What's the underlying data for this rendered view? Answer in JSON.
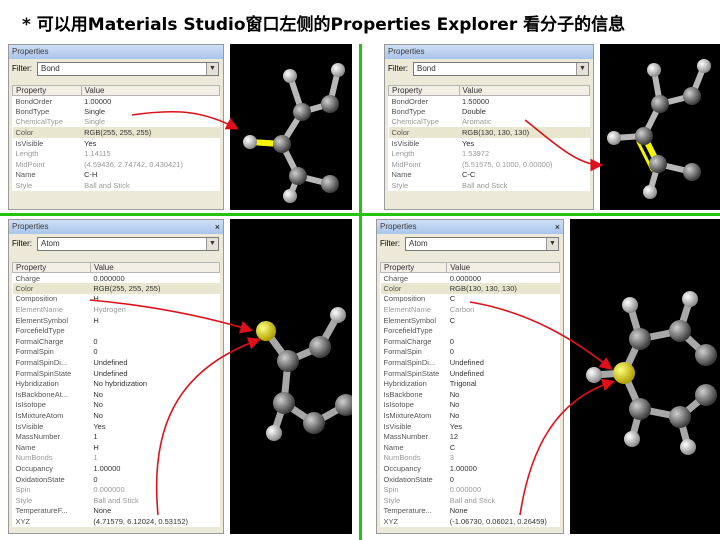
{
  "title": "* 可以用Materials Studio窗口左侧的Properties Explorer 看分子的信息",
  "colors": {
    "divider": "#22c40e",
    "arrow": "#e0101a",
    "highlight_atom": "#e8e000",
    "hydrogen": "#e6e6e6",
    "carbon": "#8a8a8a"
  },
  "panels": [
    {
      "id": "top-left",
      "header": "Properties",
      "filter_label": "Filter:",
      "filter_value": "Bond",
      "col_property": "Property",
      "col_value": "Value",
      "rows": [
        {
          "p": "BondOrder",
          "v": "1.00000",
          "dim": false,
          "hl": false
        },
        {
          "p": "BondType",
          "v": "Single",
          "dim": false,
          "hl": false
        },
        {
          "p": "ChemicalType",
          "v": "Single",
          "dim": true,
          "hl": false
        },
        {
          "p": "Color",
          "v": "RGB(255, 255, 255)",
          "dim": false,
          "hl": true
        },
        {
          "p": "IsVisible",
          "v": "Yes",
          "dim": false,
          "hl": false
        },
        {
          "p": "Length",
          "v": "1.14115",
          "dim": true,
          "hl": false
        },
        {
          "p": "MidPoint",
          "v": "(4.59436, 2.74742, 0.430421)",
          "dim": true,
          "hl": false
        },
        {
          "p": "Name",
          "v": "C-H",
          "dim": false,
          "hl": false
        },
        {
          "p": "Style",
          "v": "Ball and Stick",
          "dim": true,
          "hl": false
        }
      ]
    },
    {
      "id": "top-right",
      "header": "Properties",
      "filter_label": "Filter:",
      "filter_value": "Bond",
      "col_property": "Property",
      "col_value": "Value",
      "rows": [
        {
          "p": "BondOrder",
          "v": "1.50000",
          "dim": false,
          "hl": false
        },
        {
          "p": "BondType",
          "v": "Double",
          "dim": false,
          "hl": false
        },
        {
          "p": "ChemicalType",
          "v": "Aromatic",
          "dim": true,
          "hl": false
        },
        {
          "p": "Color",
          "v": "RGB(130, 130, 130)",
          "dim": false,
          "hl": true
        },
        {
          "p": "IsVisible",
          "v": "Yes",
          "dim": false,
          "hl": false
        },
        {
          "p": "Length",
          "v": "1.53972",
          "dim": true,
          "hl": false
        },
        {
          "p": "MidPoint",
          "v": "(5.51575, 0.1000, 0.00000)",
          "dim": true,
          "hl": false
        },
        {
          "p": "Name",
          "v": "C-C",
          "dim": false,
          "hl": false
        },
        {
          "p": "Style",
          "v": "Ball and Stick",
          "dim": true,
          "hl": false
        }
      ]
    },
    {
      "id": "bottom-left",
      "header": "Properties",
      "filter_label": "Filter:",
      "filter_value": "Atom",
      "col_property": "Property",
      "col_value": "Value",
      "rows": [
        {
          "p": "Charge",
          "v": "0.000000",
          "dim": false,
          "hl": false
        },
        {
          "p": "Color",
          "v": "RGB(255, 255, 255)",
          "dim": false,
          "hl": true
        },
        {
          "p": "Composition",
          "v": "H",
          "dim": false,
          "hl": false
        },
        {
          "p": "ElementName",
          "v": "Hydrogen",
          "dim": true,
          "hl": false
        },
        {
          "p": "ElementSymbol",
          "v": "H",
          "dim": false,
          "hl": false
        },
        {
          "p": "ForcefieldType",
          "v": "",
          "dim": false,
          "hl": false
        },
        {
          "p": "FormalCharge",
          "v": "0",
          "dim": false,
          "hl": false
        },
        {
          "p": "FormalSpin",
          "v": "0",
          "dim": false,
          "hl": false
        },
        {
          "p": "FormalSpinDi...",
          "v": "Undefined",
          "dim": false,
          "hl": false
        },
        {
          "p": "FormalSpinState",
          "v": "Undefined",
          "dim": false,
          "hl": false
        },
        {
          "p": "Hybridization",
          "v": "No hybridization",
          "dim": false,
          "hl": false
        },
        {
          "p": "IsBackboneAt...",
          "v": "No",
          "dim": false,
          "hl": false
        },
        {
          "p": "IsIsotope",
          "v": "No",
          "dim": false,
          "hl": false
        },
        {
          "p": "IsMixtureAtom",
          "v": "No",
          "dim": false,
          "hl": false
        },
        {
          "p": "IsVisible",
          "v": "Yes",
          "dim": false,
          "hl": false
        },
        {
          "p": "MassNumber",
          "v": "1",
          "dim": false,
          "hl": false
        },
        {
          "p": "Name",
          "v": "H",
          "dim": false,
          "hl": false
        },
        {
          "p": "NumBonds",
          "v": "1",
          "dim": true,
          "hl": false
        },
        {
          "p": "Occupancy",
          "v": "1.00000",
          "dim": false,
          "hl": false
        },
        {
          "p": "OxidationState",
          "v": "0",
          "dim": false,
          "hl": false
        },
        {
          "p": "Spin",
          "v": "0.000000",
          "dim": true,
          "hl": false
        },
        {
          "p": "Style",
          "v": "Ball and Stick",
          "dim": true,
          "hl": false
        },
        {
          "p": "TemperatureF...",
          "v": "None",
          "dim": false,
          "hl": false
        },
        {
          "p": "XYZ",
          "v": "(4.71579, 6.12024, 0.53152)",
          "dim": false,
          "hl": false
        }
      ]
    },
    {
      "id": "bottom-right",
      "header": "Properties",
      "filter_label": "Filter:",
      "filter_value": "Atom",
      "col_property": "Property",
      "col_value": "Value",
      "rows": [
        {
          "p": "Charge",
          "v": "0.000000",
          "dim": false,
          "hl": false
        },
        {
          "p": "Color",
          "v": "RGB(130, 130, 130)",
          "dim": false,
          "hl": true
        },
        {
          "p": "Composition",
          "v": "C",
          "dim": false,
          "hl": false
        },
        {
          "p": "ElementName",
          "v": "Carbon",
          "dim": true,
          "hl": false
        },
        {
          "p": "ElementSymbol",
          "v": "C",
          "dim": false,
          "hl": false
        },
        {
          "p": "ForcefieldType",
          "v": "",
          "dim": false,
          "hl": false
        },
        {
          "p": "FormalCharge",
          "v": "0",
          "dim": false,
          "hl": false
        },
        {
          "p": "FormalSpin",
          "v": "0",
          "dim": false,
          "hl": false
        },
        {
          "p": "FormalSpinDi...",
          "v": "Undefined",
          "dim": false,
          "hl": false
        },
        {
          "p": "FormalSpinState",
          "v": "Undefined",
          "dim": false,
          "hl": false
        },
        {
          "p": "Hybridization",
          "v": "Trigonal",
          "dim": false,
          "hl": false
        },
        {
          "p": "IsBackbone",
          "v": "No",
          "dim": false,
          "hl": false
        },
        {
          "p": "IsIsotope",
          "v": "No",
          "dim": false,
          "hl": false
        },
        {
          "p": "IsMixtureAtom",
          "v": "No",
          "dim": false,
          "hl": false
        },
        {
          "p": "IsVisible",
          "v": "Yes",
          "dim": false,
          "hl": false
        },
        {
          "p": "MassNumber",
          "v": "12",
          "dim": false,
          "hl": false
        },
        {
          "p": "Name",
          "v": "C",
          "dim": false,
          "hl": false
        },
        {
          "p": "NumBonds",
          "v": "3",
          "dim": true,
          "hl": false
        },
        {
          "p": "Occupancy",
          "v": "1.00000",
          "dim": false,
          "hl": false
        },
        {
          "p": "OxidationState",
          "v": "0",
          "dim": false,
          "hl": false
        },
        {
          "p": "Spin",
          "v": "0.000000",
          "dim": true,
          "hl": false
        },
        {
          "p": "Style",
          "v": "Ball and Stick",
          "dim": true,
          "hl": false
        },
        {
          "p": "Temperature...",
          "v": "None",
          "dim": false,
          "hl": false
        },
        {
          "p": "XYZ",
          "v": "(-1.06730, 0.06021, 0.26459)",
          "dim": false,
          "hl": false
        }
      ]
    }
  ]
}
